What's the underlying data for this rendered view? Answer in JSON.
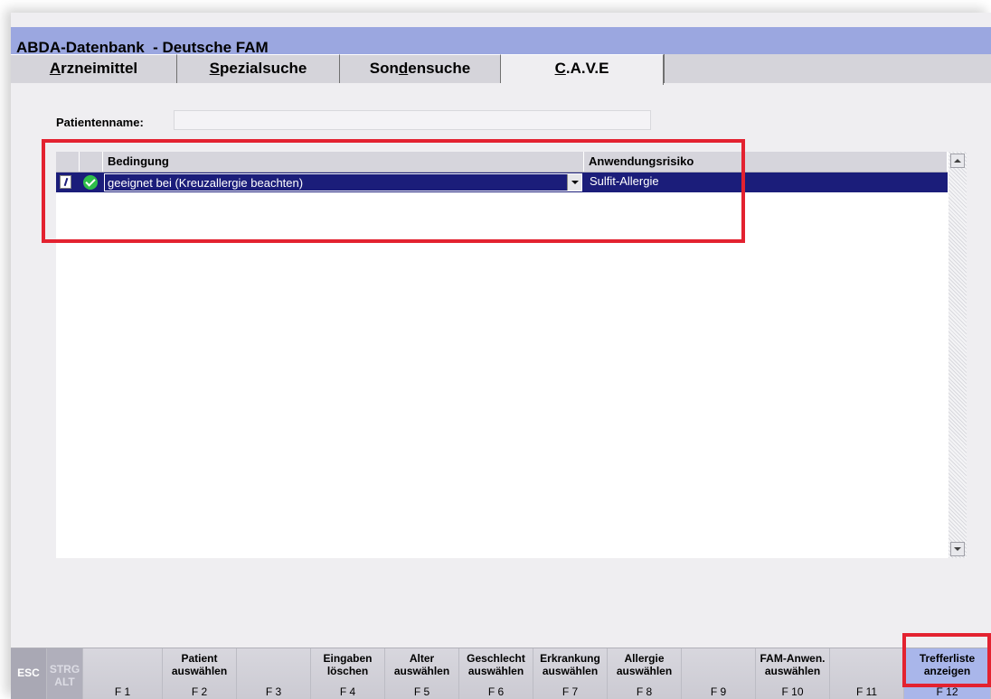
{
  "window": {
    "title": "ABDA-Datenbank  - Deutsche FAM"
  },
  "tabs": [
    {
      "label_pre": "",
      "label_ul": "A",
      "label_post": "rzneimittel"
    },
    {
      "label_pre": "",
      "label_ul": "S",
      "label_post": "pezialsuche"
    },
    {
      "label_pre": "Son",
      "label_ul": "d",
      "label_post": "ensuche"
    },
    {
      "label_pre": "",
      "label_ul": "C",
      "label_post": ".A.V.E"
    }
  ],
  "active_tab_index": 3,
  "patient": {
    "label": "Patientenname:",
    "value": ""
  },
  "grid": {
    "columns": [
      "Bedingung",
      "Anwendungsrisiko"
    ],
    "rows": [
      {
        "condition": "geeignet bei (Kreuzallergie beachten)",
        "risk": "Sulfit-Allergie"
      }
    ]
  },
  "fkeys": [
    {
      "label": "",
      "code": "ESC"
    },
    {
      "label": "STRG\nALT",
      "code": ""
    },
    {
      "label": "",
      "code": "F 1"
    },
    {
      "label": "Patient\nauswählen",
      "code": "F 2"
    },
    {
      "label": "",
      "code": "F 3"
    },
    {
      "label": "Eingaben\nlöschen",
      "code": "F 4"
    },
    {
      "label": "Alter\nauswählen",
      "code": "F 5"
    },
    {
      "label": "Geschlecht\nauswählen",
      "code": "F 6"
    },
    {
      "label": "Erkrankung\nauswählen",
      "code": "F 7"
    },
    {
      "label": "Allergie\nauswählen",
      "code": "F 8"
    },
    {
      "label": "",
      "code": "F 9"
    },
    {
      "label": "FAM-Anwen.\nauswählen",
      "code": "F 10"
    },
    {
      "label": "",
      "code": "F 11"
    },
    {
      "label": "Trefferliste\nanzeigen",
      "code": "F 12"
    }
  ],
  "colors": {
    "title_bar": "#9ba7e0",
    "selection": "#1b1d7a",
    "highlight": "#e32230",
    "ok_icon": "#2fbf4a"
  }
}
